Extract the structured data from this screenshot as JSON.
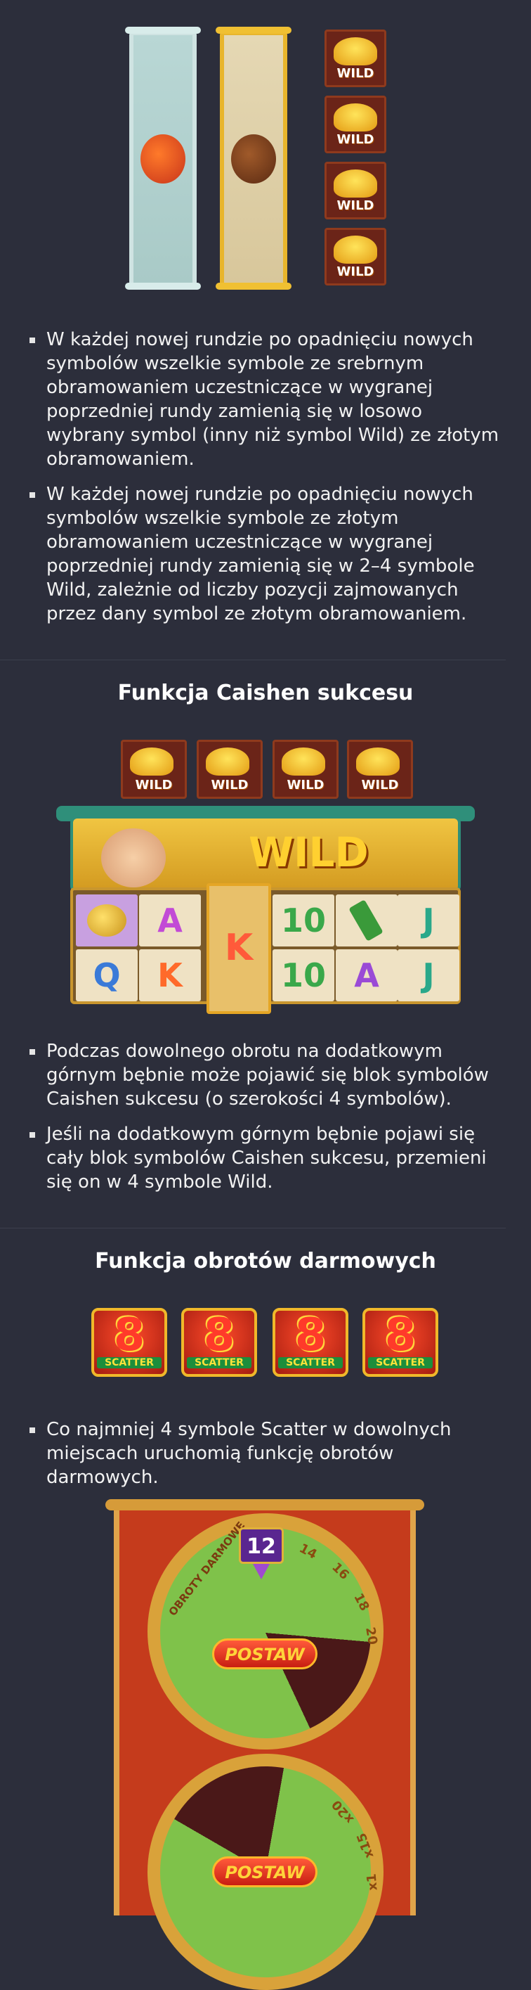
{
  "section1": {
    "wild_tiles": [
      "WILD",
      "WILD",
      "WILD",
      "WILD"
    ],
    "bullets": [
      "W każdej nowej rundzie po opadnięciu nowych symbolów wszelkie symbole ze srebrnym obramowaniem uczestniczące w wygranej poprzedniej rundy zamienią się w losowo wybrany symbol (inny niż symbol Wild) ze złotym obramowaniem.",
      "W każdej nowej rundzie po opadnięciu nowych symbolów wszelkie symbole ze złotym obramowaniem uczestniczące w wygranej poprzedniej rundy zamienią się w 2–4 symbole Wild, zależnie od liczby pozycji zajmowanych przez dany symbol ze złotym obramowaniem."
    ]
  },
  "caishen": {
    "title": "Funkcja Caishen sukcesu",
    "top_wilds": [
      "WILD",
      "WILD",
      "WILD",
      "WILD"
    ],
    "banner_wild": "WILD",
    "row1": [
      "",
      "A",
      "K",
      "10",
      "",
      "J"
    ],
    "row2": [
      "Q",
      "K",
      "",
      "10",
      "A",
      "J"
    ],
    "bullets": [
      "Podczas dowolnego obrotu na dodatkowym górnym bębnie może pojawić się blok symbolów Caishen sukcesu (o szerokości 4 symbolów).",
      "Jeśli na dodatkowym górnym bębnie pojawi się cały blok symbolów Caishen sukcesu, przemieni się on w 4 symbole Wild."
    ]
  },
  "free_spins": {
    "title": "Funkcja obrotów darmowych",
    "scatter_number": "8",
    "scatters": [
      "SCATTER",
      "SCATTER",
      "SCATTER",
      "SCATTER"
    ],
    "bullets": [
      "Co najmniej 4 symbole Scatter w dowolnych miejscach uruchomią funkcję obrotów darmowych."
    ],
    "wheel": {
      "badge": "12",
      "arc_label": "OBROTY DARMOWE",
      "ticks": [
        "14",
        "16",
        "18",
        "20"
      ],
      "multipliers": [
        "x20",
        "x15",
        "x1"
      ],
      "button_top": "POSTAW",
      "button_bottom": "POSTAW"
    }
  },
  "colors": {
    "background": "#2c2e3b",
    "accent_gold": "#e8b52c",
    "wheel_green": "#7fc24a",
    "panel_red": "#c53b1c"
  }
}
